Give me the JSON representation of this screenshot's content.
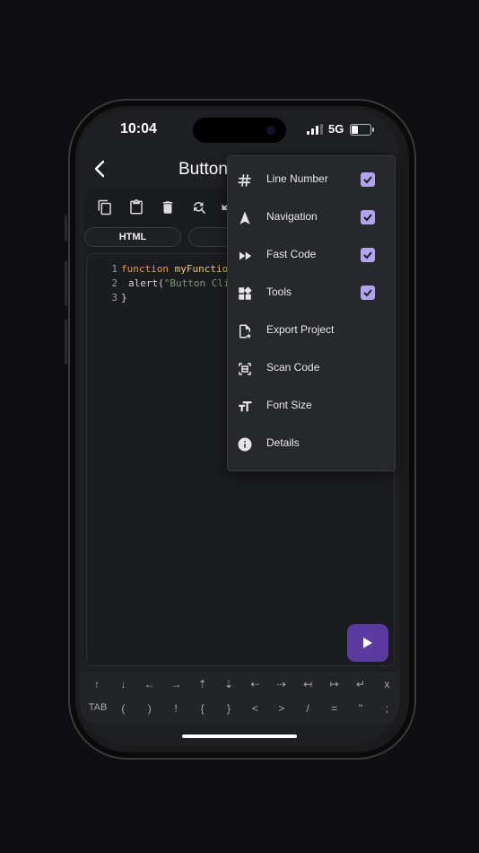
{
  "status": {
    "time": "10:04",
    "network": "5G",
    "battery_level": 0.35
  },
  "appbar": {
    "title": "Button"
  },
  "tabs": [
    "HTML",
    ""
  ],
  "code": {
    "lines": [
      {
        "num": "1",
        "kw": "function",
        "name": "myFunction",
        "rest": ""
      },
      {
        "num": "2",
        "text1": "alert(",
        "str": "\"Button Clicke"
      },
      {
        "num": "3",
        "text": "}"
      }
    ]
  },
  "toolbar": {
    "icons": [
      "copy-icon",
      "paste-icon",
      "delete-icon",
      "find-replace-icon",
      "undo-icon"
    ]
  },
  "menu": {
    "items": [
      {
        "label": "Line Number",
        "icon": "hash-icon",
        "checked": true
      },
      {
        "label": "Navigation",
        "icon": "navigation-icon",
        "checked": true
      },
      {
        "label": "Fast Code",
        "icon": "fast-forward-icon",
        "checked": true
      },
      {
        "label": "Tools",
        "icon": "widgets-icon",
        "checked": true
      },
      {
        "label": "Export Project",
        "icon": "export-file-icon",
        "checked": null
      },
      {
        "label": "Scan Code",
        "icon": "scan-icon",
        "checked": null
      },
      {
        "label": "Font Size",
        "icon": "font-size-icon",
        "checked": null
      },
      {
        "label": "Details",
        "icon": "info-icon",
        "checked": null
      }
    ]
  },
  "keyboard": {
    "row1": [
      "↑",
      "↓",
      "←",
      "→",
      "⇡",
      "⇣",
      "⇠",
      "⇢",
      "↤",
      "↦",
      "↵",
      "x"
    ],
    "row2": [
      "TAB",
      "(",
      ")",
      "!",
      "{",
      "}",
      "<",
      ">",
      "/",
      "=",
      "\"",
      ";"
    ]
  },
  "colors": {
    "accent": "#5b3b9f",
    "checkbox": "#b3a3ef",
    "keyword": "#e49b3f",
    "function_name": "#f0c66b",
    "string": "#7f9a6f"
  }
}
